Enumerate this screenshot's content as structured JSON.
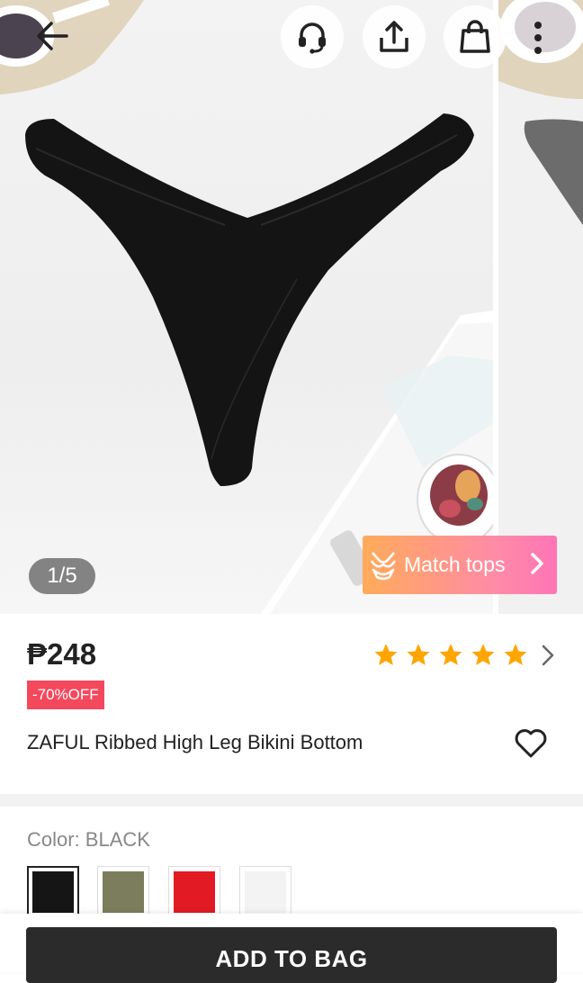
{
  "gallery": {
    "page_indicator": "1/5",
    "match_tops_label": "Match tops",
    "icons": {
      "back": "back-arrow-icon",
      "support": "headset-icon",
      "share": "share-icon",
      "bag": "shopping-bag-icon",
      "more": "more-vertical-icon"
    }
  },
  "product": {
    "price": "₱248",
    "discount": "-70%OFF",
    "rating_stars": 5,
    "title": "ZAFUL Ribbed High Leg Bikini Bottom"
  },
  "color": {
    "label": "Color: BLACK",
    "swatches": [
      {
        "name": "black",
        "color": "#151515",
        "selected": true
      },
      {
        "name": "olive",
        "color": "#7c7d5c",
        "selected": false
      },
      {
        "name": "red",
        "color": "#e11a24",
        "selected": false
      },
      {
        "name": "white",
        "color": "#f3f3f3",
        "selected": false
      }
    ]
  },
  "actions": {
    "add_to_bag": "ADD TO BAG"
  },
  "colors": {
    "star": "#ffa500",
    "badge": "#f4485d",
    "button": "#2b2b2b"
  }
}
